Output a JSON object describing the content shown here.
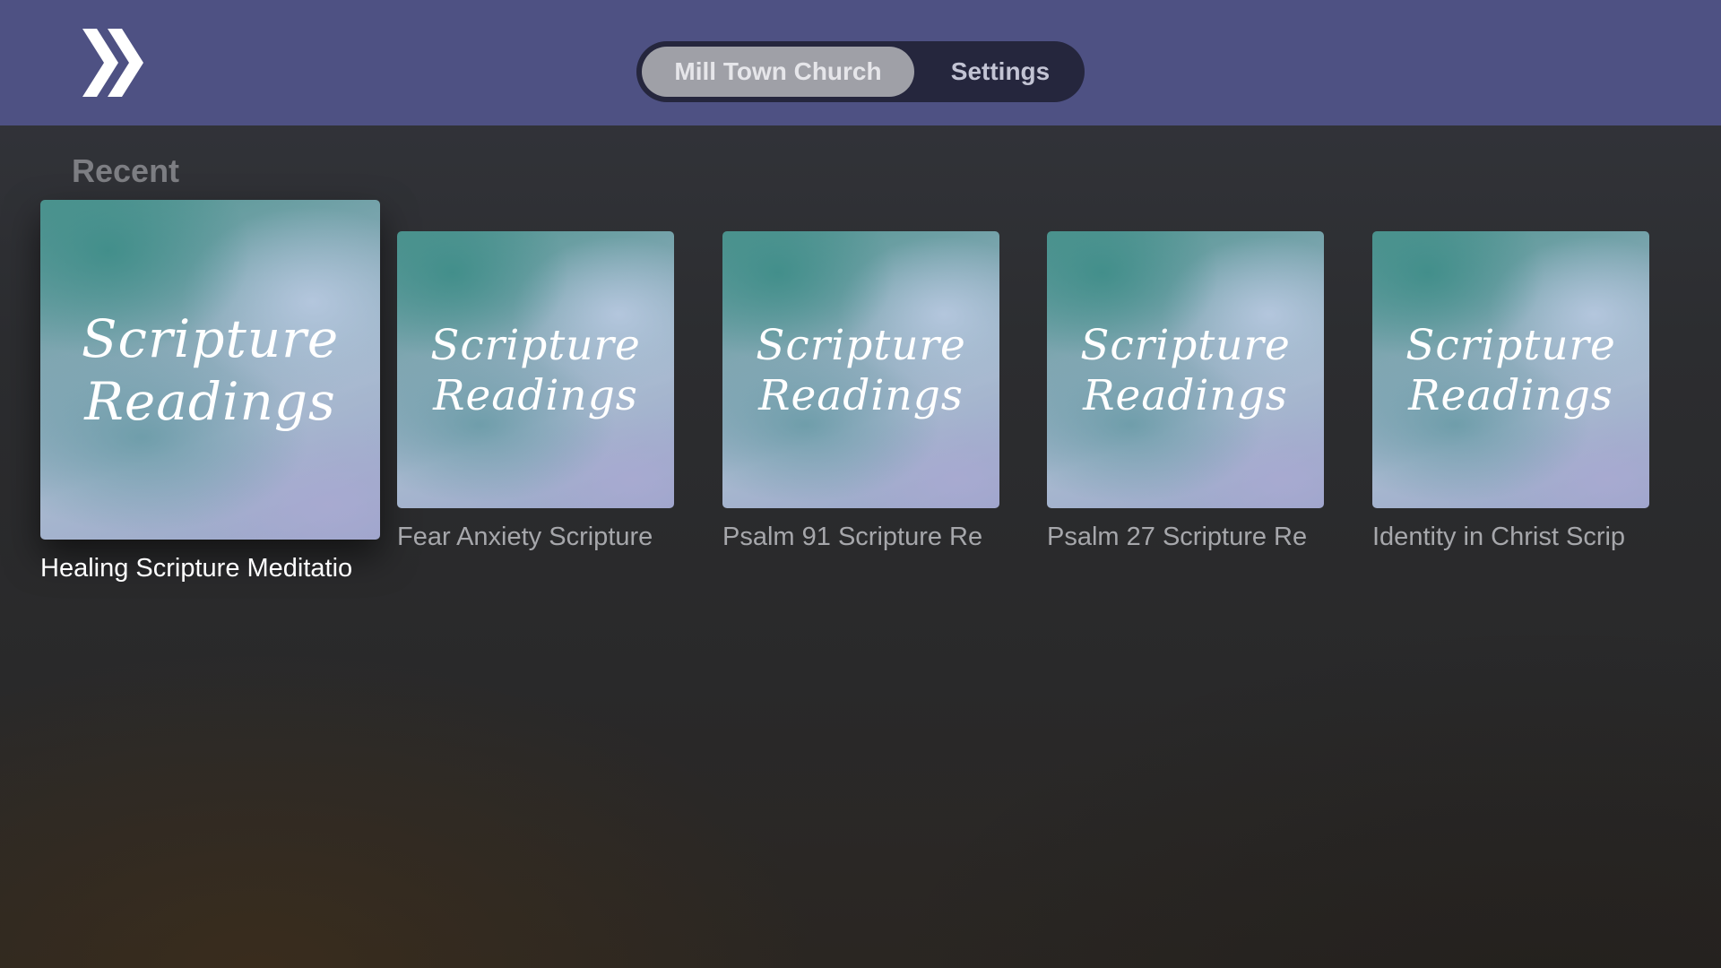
{
  "header": {
    "logo_icon": "double-chevron-right-icon",
    "tabs": [
      {
        "label": "Mill Town Church",
        "selected": true
      },
      {
        "label": "Settings",
        "selected": false
      }
    ]
  },
  "recent": {
    "title": "Recent",
    "items": [
      {
        "artwork_line1": "Scripture",
        "artwork_line2": "Readings",
        "caption": "Healing Scripture Meditatio",
        "focused": true
      },
      {
        "artwork_line1": "Scripture",
        "artwork_line2": "Readings",
        "caption": "Fear Anxiety Scripture",
        "focused": false
      },
      {
        "artwork_line1": "Scripture",
        "artwork_line2": "Readings",
        "caption": "Psalm 91 Scripture Re",
        "focused": false
      },
      {
        "artwork_line1": "Scripture",
        "artwork_line2": "Readings",
        "caption": "Psalm 27 Scripture Re",
        "focused": false
      },
      {
        "artwork_line1": "Scripture",
        "artwork_line2": "Readings",
        "caption": "Identity in Christ Scrip",
        "focused": false
      }
    ]
  },
  "colors": {
    "header_bg": "#4e5183",
    "segment_bg": "#25263d",
    "segment_active": "#9fa0a7"
  }
}
